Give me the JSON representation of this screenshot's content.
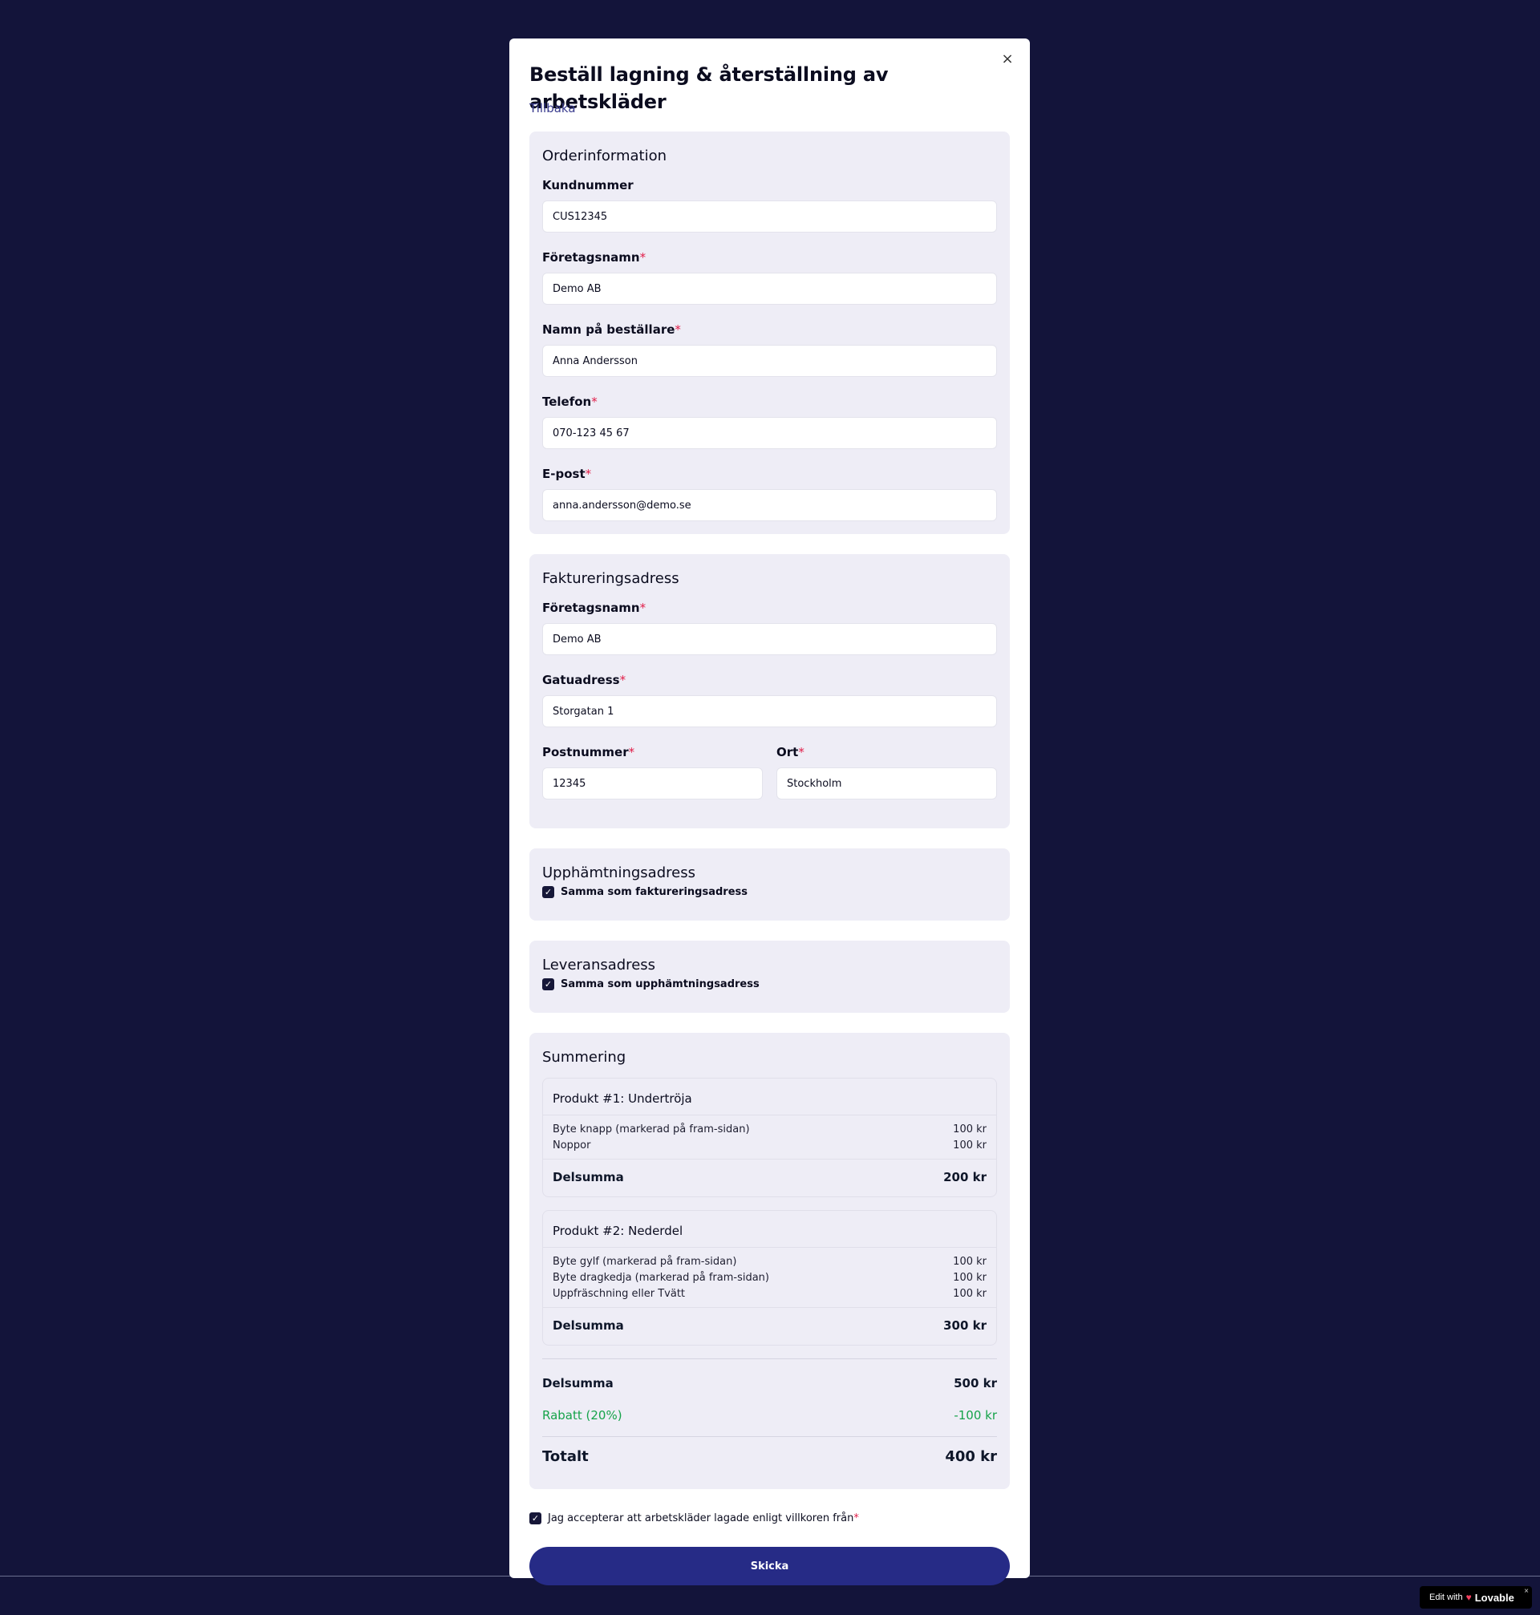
{
  "modal": {
    "title": "Beställ lagning & återställning av arbetskläder",
    "close_icon": "×",
    "back_link": "Tillbaka"
  },
  "order_info": {
    "title": "Orderinformation",
    "customer_number": {
      "label": "Kundnummer",
      "value": "CUS12345"
    },
    "company_name": {
      "label": "Företagsnamn",
      "value": "Demo AB"
    },
    "orderer_name": {
      "label": "Namn på beställare",
      "value": "Anna Andersson"
    },
    "phone": {
      "label": "Telefon",
      "value": "070-123 45 67"
    },
    "email": {
      "label": "E-post",
      "value": "anna.andersson@demo.se"
    }
  },
  "billing": {
    "title": "Faktureringsadress",
    "company_name": {
      "label": "Företagsnamn",
      "value": "Demo AB"
    },
    "street": {
      "label": "Gatuadress",
      "value": "Storgatan 1"
    },
    "postal_code": {
      "label": "Postnummer",
      "value": "12345"
    },
    "city": {
      "label": "Ort",
      "value": "Stockholm"
    }
  },
  "pickup": {
    "title": "Upphämtningsadress",
    "same_as_label": "Samma som faktureringsadress",
    "checked": true
  },
  "delivery": {
    "title": "Leveransadress",
    "same_as_label": "Samma som upphämtningsadress",
    "checked": true
  },
  "summary": {
    "title": "Summering",
    "products": [
      {
        "title": "Produkt #1: Undertröja",
        "lines": [
          {
            "name": "Byte knapp (markerad på fram-sidan)",
            "price": "100 kr"
          },
          {
            "name": "Noppor",
            "price": "100 kr"
          }
        ],
        "subtotal_label": "Delsumma",
        "subtotal": "200 kr"
      },
      {
        "title": "Produkt #2: Nederdel",
        "lines": [
          {
            "name": "Byte gylf (markerad på fram-sidan)",
            "price": "100 kr"
          },
          {
            "name": "Byte dragkedja (markerad på fram-sidan)",
            "price": "100 kr"
          },
          {
            "name": "Uppfräschning eller Tvätt",
            "price": "100 kr"
          }
        ],
        "subtotal_label": "Delsumma",
        "subtotal": "300 kr"
      }
    ],
    "subtotal_label": "Delsumma",
    "subtotal": "500 kr",
    "discount_label": "Rabatt (20%)",
    "discount": "-100 kr",
    "total_label": "Totalt",
    "total": "400 kr"
  },
  "terms": {
    "label": "Jag accepterar att arbetskläder lagade enligt villkoren från",
    "checked": true
  },
  "submit_label": "Skicka",
  "badge": {
    "prefix": "Edit with",
    "brand": "Lovable",
    "close": "×"
  },
  "colors": {
    "background": "#13143a",
    "accent": "#262b86",
    "discount": "#16a34a",
    "required": "#e11d48"
  }
}
